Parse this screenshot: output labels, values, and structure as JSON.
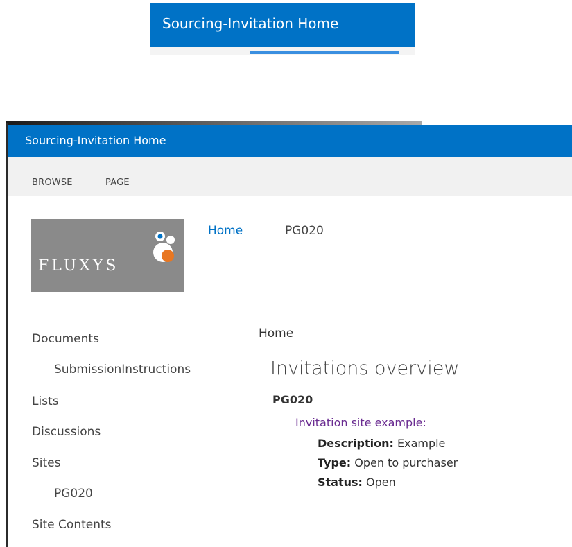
{
  "snippet": {
    "title": "Sourcing-Invitation Home"
  },
  "suite_bar": {
    "title": "Sourcing-Invitation Home"
  },
  "ribbon": {
    "tabs": [
      "BROWSE",
      "PAGE"
    ]
  },
  "logo": {
    "text": "FLUXYS",
    "colors": {
      "background": "#8a8a8a",
      "orange": "#e87722",
      "blue": "#0072c6"
    }
  },
  "top_nav": {
    "items": [
      "Home",
      "PG020"
    ]
  },
  "left_nav": {
    "items": [
      {
        "label": "Documents"
      },
      {
        "label": "SubmissionInstructions"
      },
      {
        "label": "Lists"
      },
      {
        "label": "Discussions"
      },
      {
        "label": "Sites"
      },
      {
        "label": "PG020"
      },
      {
        "label": "Site Contents"
      }
    ]
  },
  "main": {
    "breadcrumb": "Home",
    "title": "Invitations overview",
    "site_name": "PG020",
    "invitation": {
      "link": "Invitation site example:",
      "fields": [
        {
          "label": "Description:",
          "value": "Example"
        },
        {
          "label": "Type:",
          "value": "Open to purchaser"
        },
        {
          "label": "Status:",
          "value": "Open"
        }
      ]
    }
  },
  "colors": {
    "suite_blue": "#0072c6",
    "link_blue": "#0072c6",
    "visited_purple": "#6a2c91"
  }
}
